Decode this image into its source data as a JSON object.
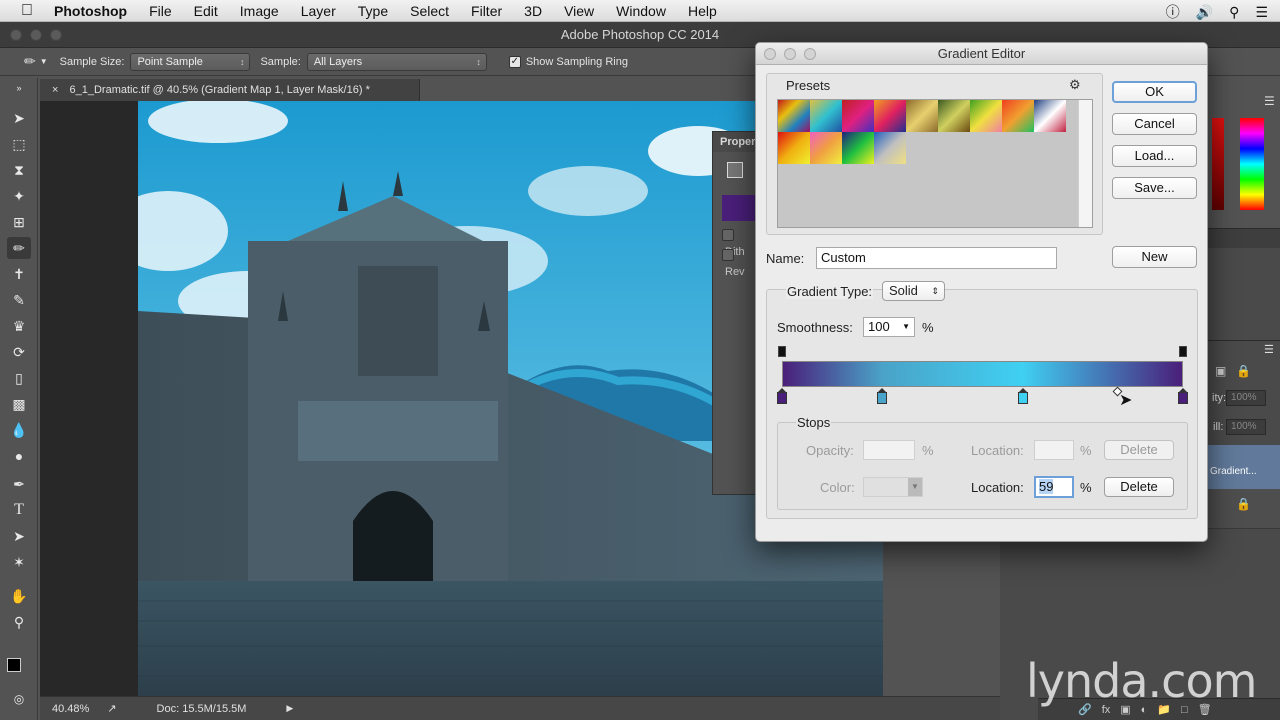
{
  "menubar": {
    "app_name": "Photoshop",
    "items": [
      "File",
      "Edit",
      "Image",
      "Layer",
      "Type",
      "Select",
      "Filter",
      "3D",
      "View",
      "Window",
      "Help"
    ]
  },
  "window": {
    "title": "Adobe Photoshop CC 2014"
  },
  "options_bar": {
    "sample_size_label": "Sample Size:",
    "sample_size_value": "Point Sample",
    "sample_label": "Sample:",
    "sample_value": "All Layers",
    "show_sampling_ring_label": "Show Sampling Ring",
    "show_sampling_ring_checked": true
  },
  "document": {
    "tab_title": "6_1_Dramatic.tif @ 40.5% (Gradient Map 1, Layer Mask/16) *",
    "zoom": "40.48%",
    "doc_size": "Doc: 15.5M/15.5M"
  },
  "properties_panel": {
    "title_fragment": "Proper",
    "dither_fragment": "Dith",
    "reverse_fragment": "Rev"
  },
  "right_panel": {
    "opacity_fragment": "ity:",
    "opacity_value": "100%",
    "fill_fragment": "ill:",
    "fill_value": "100%",
    "layer_name_fragment": "Gradient..."
  },
  "gradient_editor": {
    "title": "Gradient Editor",
    "presets_label": "Presets",
    "ok_label": "OK",
    "cancel_label": "Cancel",
    "load_label": "Load...",
    "save_label": "Save...",
    "name_label": "Name:",
    "name_value": "Custom",
    "new_label": "New",
    "gradient_type_label": "Gradient Type:",
    "gradient_type_value": "Solid",
    "smoothness_label": "Smoothness:",
    "smoothness_value": "100",
    "percent": "%",
    "stops_label": "Stops",
    "opacity_label": "Opacity:",
    "opacity_value": "",
    "opacity_location_label": "Location:",
    "opacity_location_value": "",
    "delete_label": "Delete",
    "color_label": "Color:",
    "color_location_label": "Location:",
    "color_location_value": "59",
    "color_stops": [
      {
        "location": 0,
        "color": "#4a1f7a"
      },
      {
        "location": 25,
        "color": "#4aa3c8"
      },
      {
        "location": 60,
        "color": "#3fd0f2"
      },
      {
        "location": 100,
        "color": "#4a1f7a"
      }
    ],
    "opacity_stops": [
      0,
      100
    ],
    "preset_gradients": [
      [
        "#c01818",
        "#e8c010",
        "#2080c0",
        "#a01060"
      ],
      [
        "#e0c040",
        "#30c0d0",
        "#2050a0"
      ],
      [
        "#c02020",
        "#e02080",
        "#4030c0"
      ],
      [
        "#f0a020",
        "#e02060",
        "#203090"
      ],
      [
        "#8b6b2b",
        "#e8d070",
        "#8b6b2b"
      ],
      [
        "#3b5b20",
        "#d0d060",
        "#6b4a10"
      ],
      [
        "#40a020",
        "#f0e040",
        "#f080a0"
      ],
      [
        "#f04020",
        "#f0a030",
        "#20c060"
      ],
      [
        "#204080",
        "#ffffff",
        "#c02040"
      ],
      [
        "#e01010",
        "#f0b010",
        "#f0f030"
      ],
      [
        "#f060c0",
        "#f0a040",
        "#f0f040"
      ],
      [
        "#202080",
        "#20c040",
        "#f0f020"
      ],
      [
        "#2060c0",
        "#c0c0c0",
        "#f0e080"
      ]
    ]
  },
  "watermark": {
    "text": "lynda.com"
  }
}
